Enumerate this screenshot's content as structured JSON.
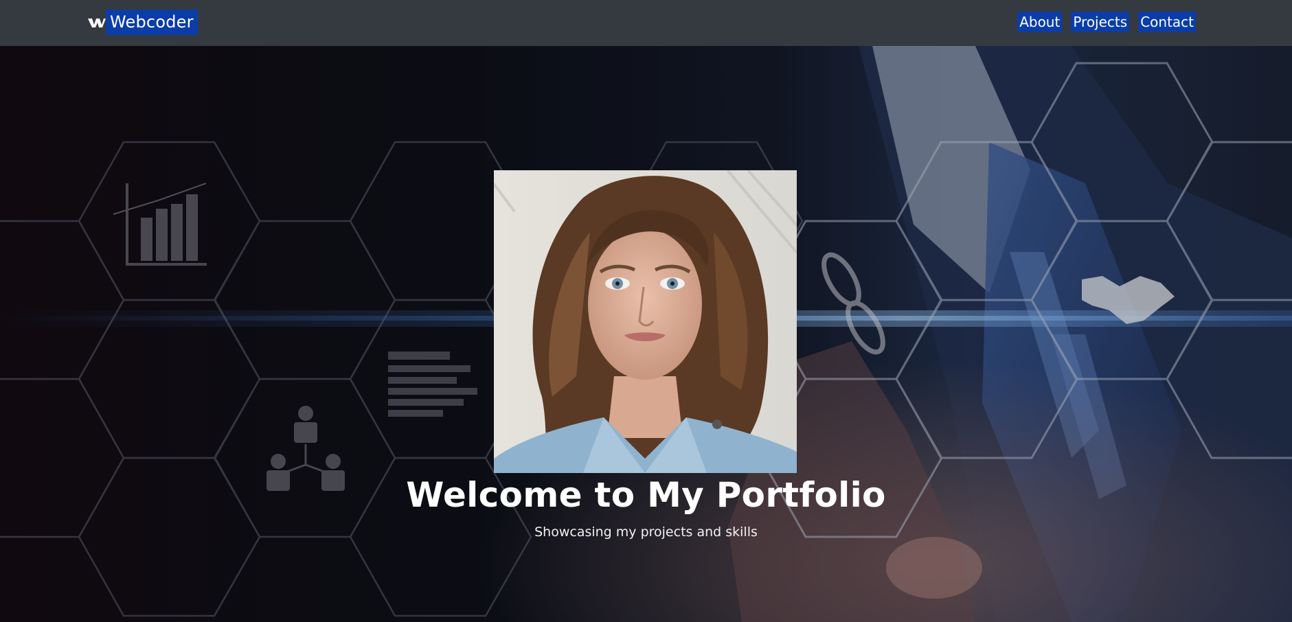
{
  "navbar": {
    "brand_text": "Webcoder",
    "links": [
      {
        "label": "About"
      },
      {
        "label": "Projects"
      },
      {
        "label": "Contact"
      }
    ]
  },
  "hero": {
    "title": "Welcome to My Portfolio",
    "subtitle": "Showcasing my projects and skills",
    "background_icons": [
      "bar-chart-icon",
      "people-network-icon",
      "document-lines-icon",
      "chain-link-icon",
      "handshake-icon"
    ]
  },
  "colors": {
    "navbar_bg": "#343a40",
    "link_highlight": "#0b3da8",
    "text": "#ffffff"
  }
}
